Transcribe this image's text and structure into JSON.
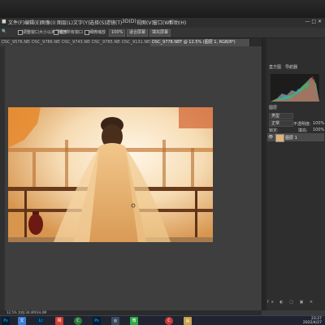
{
  "menubar": {
    "items": [
      "文件(F)",
      "编辑(E)",
      "图像(I)",
      "图层(L)",
      "文字(Y)",
      "选择(S)",
      "滤镜(T)",
      "3D(D)",
      "视图(V)",
      "窗口(W)",
      "帮助(H)"
    ],
    "window_controls": "—  □  ✕"
  },
  "optionsbar": {
    "resize_windows": "调整窗口大小以满屏显示",
    "zoom_all": "缩放所有窗口",
    "scrubby_zoom": "细微缩放",
    "zoom_value": "100%",
    "fit_screen": "适合屏幕",
    "fill_screen": "填充屏幕"
  },
  "tabs": [
    "DSC_9576.NEF",
    "DSC_9786.NEF",
    "DSC_9743.NEF",
    "DSC_9785.NEF",
    "DSC_9131.NEF",
    "DSC_9778.NEF @ 12.5% (图层 1, RGB/8*)"
  ],
  "panels": {
    "histogram_tab": "直方图",
    "navigator_tab": "导航器",
    "layers_tab": "图层",
    "kind_filter": "类型",
    "blend_mode": "正常",
    "opacity_label": "不透明度:",
    "opacity_value": "100%",
    "lock_label": "锁定:",
    "fill_label": "填充:",
    "fill_value": "100%",
    "layer_name": "图层 1",
    "footer_icons": "fx ◐ ▢ ▣ ✕"
  },
  "statusbar": {
    "text": "12.5%   文档:34.4M/34.4M"
  },
  "taskbar": {
    "apps": [
      "Ps",
      "文",
      "Lr",
      "网",
      "C",
      "Ps",
      "◎",
      "微",
      "C",
      "▤"
    ],
    "time": "23:27",
    "date": "2022/4/27"
  },
  "colors": {
    "ps_dark": "#2e2e2e",
    "canvas_bg": "#3e3e3e",
    "ps_blue": "#31a8ff",
    "photo_warm": "#e8b57a"
  }
}
